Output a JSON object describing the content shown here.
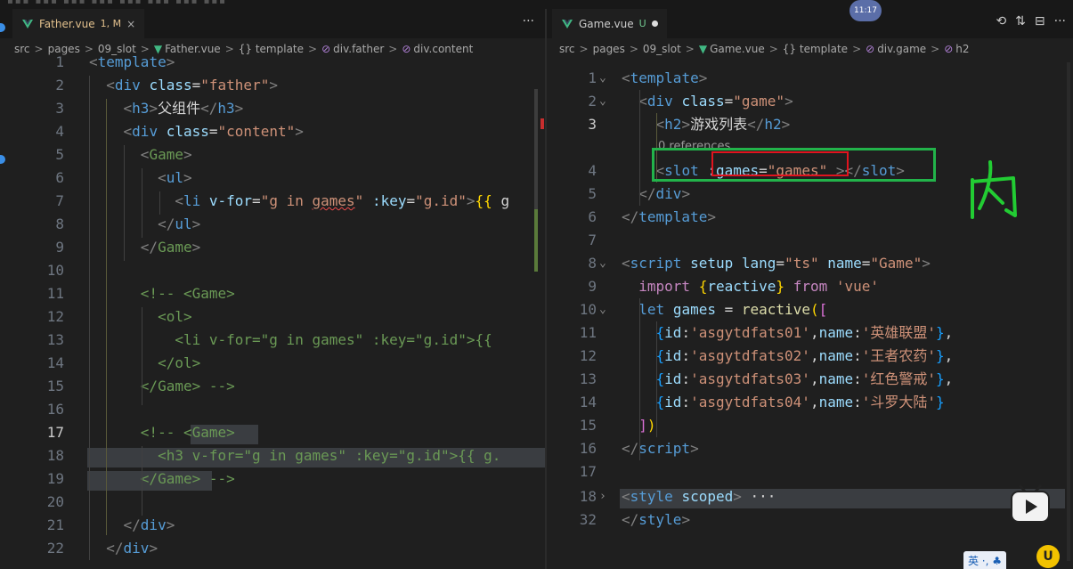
{
  "overlay": {
    "time_badge": "11:17",
    "ime_label": "英 ·, ♣",
    "u_badge": "U"
  },
  "left": {
    "tab": {
      "label": "Father.vue",
      "badge": "1, M",
      "close": "×"
    },
    "more": "···",
    "breadcrumbs": [
      "src",
      "pages",
      "09_slot",
      "Father.vue",
      "{} template",
      "div.father",
      "div.content"
    ],
    "lines": [
      {
        "n": "1",
        "parts": [
          [
            "t",
            "<"
          ],
          [
            "tn",
            "template"
          ],
          [
            "t",
            ">"
          ]
        ]
      },
      {
        "n": "2",
        "parts": [
          [
            "tx",
            "  "
          ],
          [
            "t",
            "<"
          ],
          [
            "tn",
            "div"
          ],
          [
            "tx",
            " "
          ],
          [
            "at",
            "class"
          ],
          [
            "tx",
            "="
          ],
          [
            "st",
            "\"father\""
          ],
          [
            "t",
            ">"
          ]
        ]
      },
      {
        "n": "3",
        "parts": [
          [
            "tx",
            "    "
          ],
          [
            "t",
            "<"
          ],
          [
            "tn",
            "h3"
          ],
          [
            "t",
            ">"
          ],
          [
            "tx",
            "父组件"
          ],
          [
            "t",
            "</"
          ],
          [
            "tn",
            "h3"
          ],
          [
            "t",
            ">"
          ]
        ]
      },
      {
        "n": "4",
        "parts": [
          [
            "tx",
            "    "
          ],
          [
            "t",
            "<"
          ],
          [
            "tn",
            "div"
          ],
          [
            "tx",
            " "
          ],
          [
            "at",
            "class"
          ],
          [
            "tx",
            "="
          ],
          [
            "st",
            "\"content\""
          ],
          [
            "t",
            ">"
          ]
        ]
      },
      {
        "n": "5",
        "parts": [
          [
            "tx",
            "      "
          ],
          [
            "t",
            "<"
          ],
          [
            "cmt",
            "Game"
          ],
          [
            "t",
            ">"
          ]
        ]
      },
      {
        "n": "6",
        "parts": [
          [
            "tx",
            "        "
          ],
          [
            "t",
            "<"
          ],
          [
            "tn",
            "ul"
          ],
          [
            "t",
            ">"
          ]
        ]
      },
      {
        "n": "7",
        "parts": [
          [
            "tx",
            "          "
          ],
          [
            "t",
            "<"
          ],
          [
            "tn",
            "li"
          ],
          [
            "tx",
            " "
          ],
          [
            "at",
            "v-for"
          ],
          [
            "tx",
            "="
          ],
          [
            "st",
            "\"g in "
          ],
          [
            "sq",
            "games"
          ],
          [
            "st",
            "\""
          ],
          [
            "tx",
            " "
          ],
          [
            "at",
            ":key"
          ],
          [
            "tx",
            "="
          ],
          [
            "st",
            "\"g.id\""
          ],
          [
            "t",
            ">"
          ],
          [
            "br1",
            "{{"
          ],
          [
            "tx",
            " g"
          ]
        ]
      },
      {
        "n": "8",
        "parts": [
          [
            "tx",
            "        "
          ],
          [
            "t",
            "</"
          ],
          [
            "tn",
            "ul"
          ],
          [
            "t",
            ">"
          ]
        ]
      },
      {
        "n": "9",
        "parts": [
          [
            "tx",
            "      "
          ],
          [
            "t",
            "</"
          ],
          [
            "cmt",
            "Game"
          ],
          [
            "t",
            ">"
          ]
        ]
      },
      {
        "n": "10",
        "parts": []
      },
      {
        "n": "11",
        "parts": [
          [
            "tx",
            "      "
          ],
          [
            "cm",
            "<!-- <Game>"
          ]
        ]
      },
      {
        "n": "12",
        "parts": [
          [
            "tx",
            "        "
          ],
          [
            "cm",
            "<ol>"
          ]
        ]
      },
      {
        "n": "13",
        "parts": [
          [
            "tx",
            "          "
          ],
          [
            "cm",
            "<li v-for=\"g in games\" :key=\"g.id\">{{"
          ]
        ]
      },
      {
        "n": "14",
        "parts": [
          [
            "tx",
            "        "
          ],
          [
            "cm",
            "</ol>"
          ]
        ]
      },
      {
        "n": "15",
        "parts": [
          [
            "tx",
            "      "
          ],
          [
            "cm",
            "</Game> -->"
          ]
        ]
      },
      {
        "n": "16",
        "parts": []
      },
      {
        "n": "17",
        "parts": [
          [
            "tx",
            "      "
          ],
          [
            "cm",
            "<!-- <Game>"
          ]
        ]
      },
      {
        "n": "18",
        "parts": [
          [
            "tx",
            "        "
          ],
          [
            "cm",
            "<h3 v-for=\"g in games\" :key=\"g.id\">{{ g."
          ]
        ]
      },
      {
        "n": "19",
        "parts": [
          [
            "tx",
            "      "
          ],
          [
            "cm",
            "</Game> -->"
          ]
        ]
      },
      {
        "n": "20",
        "parts": []
      },
      {
        "n": "21",
        "parts": [
          [
            "tx",
            "    "
          ],
          [
            "t",
            "</"
          ],
          [
            "tn",
            "div"
          ],
          [
            "t",
            ">"
          ]
        ]
      },
      {
        "n": "22",
        "parts": [
          [
            "tx",
            "  "
          ],
          [
            "t",
            "</"
          ],
          [
            "tn",
            "div"
          ],
          [
            "t",
            ">"
          ]
        ]
      }
    ]
  },
  "right": {
    "tab": {
      "label": "Game.vue",
      "badge": "U"
    },
    "actions": [
      "⟲",
      "⇅",
      "⊟",
      "···"
    ],
    "breadcrumbs": [
      "src",
      "pages",
      "09_slot",
      "Game.vue",
      "{} template",
      "div.game",
      "h2"
    ],
    "codelens": "0 references",
    "lines": [
      {
        "n": "1",
        "fold": "⌄",
        "parts": [
          [
            "t",
            "<"
          ],
          [
            "tn",
            "template"
          ],
          [
            "t",
            ">"
          ]
        ]
      },
      {
        "n": "2",
        "fold": "⌄",
        "parts": [
          [
            "tx",
            "  "
          ],
          [
            "t",
            "<"
          ],
          [
            "tn",
            "div"
          ],
          [
            "tx",
            " "
          ],
          [
            "at",
            "class"
          ],
          [
            "tx",
            "="
          ],
          [
            "st",
            "\"game\""
          ],
          [
            "t",
            ">"
          ]
        ]
      },
      {
        "n": "3",
        "parts": [
          [
            "tx",
            "    "
          ],
          [
            "t",
            "<"
          ],
          [
            "tn",
            "h2"
          ],
          [
            "t",
            ">"
          ],
          [
            "tx",
            "游戏列表"
          ],
          [
            "t",
            "</"
          ],
          [
            "tn",
            "h2"
          ],
          [
            "t",
            ">"
          ]
        ]
      },
      {
        "n": "4",
        "parts": [
          [
            "tx",
            "    "
          ],
          [
            "t",
            "<"
          ],
          [
            "tn",
            "slot"
          ],
          [
            "tx",
            " "
          ],
          [
            "at",
            ":games"
          ],
          [
            "tx",
            "="
          ],
          [
            "st",
            "\"games\""
          ],
          [
            "tx",
            " "
          ],
          [
            "t",
            "></"
          ],
          [
            "tn",
            "slot"
          ],
          [
            "t",
            ">"
          ]
        ]
      },
      {
        "n": "5",
        "parts": [
          [
            "tx",
            "  "
          ],
          [
            "t",
            "</"
          ],
          [
            "tn",
            "div"
          ],
          [
            "t",
            ">"
          ]
        ]
      },
      {
        "n": "6",
        "parts": [
          [
            "t",
            "</"
          ],
          [
            "tn",
            "template"
          ],
          [
            "t",
            ">"
          ]
        ]
      },
      {
        "n": "7",
        "parts": []
      },
      {
        "n": "8",
        "fold": "⌄",
        "parts": [
          [
            "t",
            "<"
          ],
          [
            "tn",
            "script"
          ],
          [
            "tx",
            " "
          ],
          [
            "at",
            "setup"
          ],
          [
            "tx",
            " "
          ],
          [
            "at",
            "lang"
          ],
          [
            "tx",
            "="
          ],
          [
            "st",
            "\"ts\""
          ],
          [
            "tx",
            " "
          ],
          [
            "at",
            "name"
          ],
          [
            "tx",
            "="
          ],
          [
            "st",
            "\"Game\""
          ],
          [
            "t",
            ">"
          ]
        ]
      },
      {
        "n": "9",
        "parts": [
          [
            "tx",
            "  "
          ],
          [
            "kc",
            "import"
          ],
          [
            "tx",
            " "
          ],
          [
            "br1",
            "{"
          ],
          [
            "at",
            "reactive"
          ],
          [
            "br1",
            "}"
          ],
          [
            "tx",
            " "
          ],
          [
            "kc",
            "from"
          ],
          [
            "tx",
            " "
          ],
          [
            "st",
            "'vue'"
          ]
        ]
      },
      {
        "n": "10",
        "fold": "⌄",
        "parts": [
          [
            "tx",
            "  "
          ],
          [
            "kw",
            "let"
          ],
          [
            "tx",
            " "
          ],
          [
            "at",
            "games"
          ],
          [
            "tx",
            " = "
          ],
          [
            "fn",
            "reactive"
          ],
          [
            "br1",
            "("
          ],
          [
            "br2",
            "["
          ]
        ]
      },
      {
        "n": "11",
        "parts": [
          [
            "tx",
            "    "
          ],
          [
            "br3",
            "{"
          ],
          [
            "at",
            "id"
          ],
          [
            "tx",
            ":"
          ],
          [
            "st",
            "'asgytdfats01'"
          ],
          [
            "tx",
            ","
          ],
          [
            "at",
            "name"
          ],
          [
            "tx",
            ":"
          ],
          [
            "st",
            "'英雄联盟'"
          ],
          [
            "br3",
            "}"
          ],
          [
            "tx",
            ","
          ]
        ]
      },
      {
        "n": "12",
        "parts": [
          [
            "tx",
            "    "
          ],
          [
            "br3",
            "{"
          ],
          [
            "at",
            "id"
          ],
          [
            "tx",
            ":"
          ],
          [
            "st",
            "'asgytdfats02'"
          ],
          [
            "tx",
            ","
          ],
          [
            "at",
            "name"
          ],
          [
            "tx",
            ":"
          ],
          [
            "st",
            "'王者农药'"
          ],
          [
            "br3",
            "}"
          ],
          [
            "tx",
            ","
          ]
        ]
      },
      {
        "n": "13",
        "parts": [
          [
            "tx",
            "    "
          ],
          [
            "br3",
            "{"
          ],
          [
            "at",
            "id"
          ],
          [
            "tx",
            ":"
          ],
          [
            "st",
            "'asgytdfats03'"
          ],
          [
            "tx",
            ","
          ],
          [
            "at",
            "name"
          ],
          [
            "tx",
            ":"
          ],
          [
            "st",
            "'红色警戒'"
          ],
          [
            "br3",
            "}"
          ],
          [
            "tx",
            ","
          ]
        ]
      },
      {
        "n": "14",
        "parts": [
          [
            "tx",
            "    "
          ],
          [
            "br3",
            "{"
          ],
          [
            "at",
            "id"
          ],
          [
            "tx",
            ":"
          ],
          [
            "st",
            "'asgytdfats04'"
          ],
          [
            "tx",
            ","
          ],
          [
            "at",
            "name"
          ],
          [
            "tx",
            ":"
          ],
          [
            "st",
            "'斗罗大陆'"
          ],
          [
            "br3",
            "}"
          ]
        ]
      },
      {
        "n": "15",
        "parts": [
          [
            "tx",
            "  "
          ],
          [
            "br2",
            "]"
          ],
          [
            "br1",
            ")"
          ]
        ]
      },
      {
        "n": "16",
        "parts": [
          [
            "t",
            "</"
          ],
          [
            "tn",
            "script"
          ],
          [
            "t",
            ">"
          ]
        ]
      },
      {
        "n": "17",
        "parts": []
      },
      {
        "n": "18",
        "fold": "›",
        "parts": [
          [
            "t",
            "<"
          ],
          [
            "tn",
            "style"
          ],
          [
            "tx",
            " "
          ],
          [
            "at",
            "scoped"
          ],
          [
            "t",
            ">"
          ],
          [
            "tx",
            " ···"
          ]
        ]
      },
      {
        "n": "32",
        "parts": [
          [
            "t",
            "</"
          ],
          [
            "tn",
            "style"
          ],
          [
            "t",
            ">"
          ]
        ]
      }
    ]
  },
  "annotation": {
    "handwritten_char": "内"
  }
}
